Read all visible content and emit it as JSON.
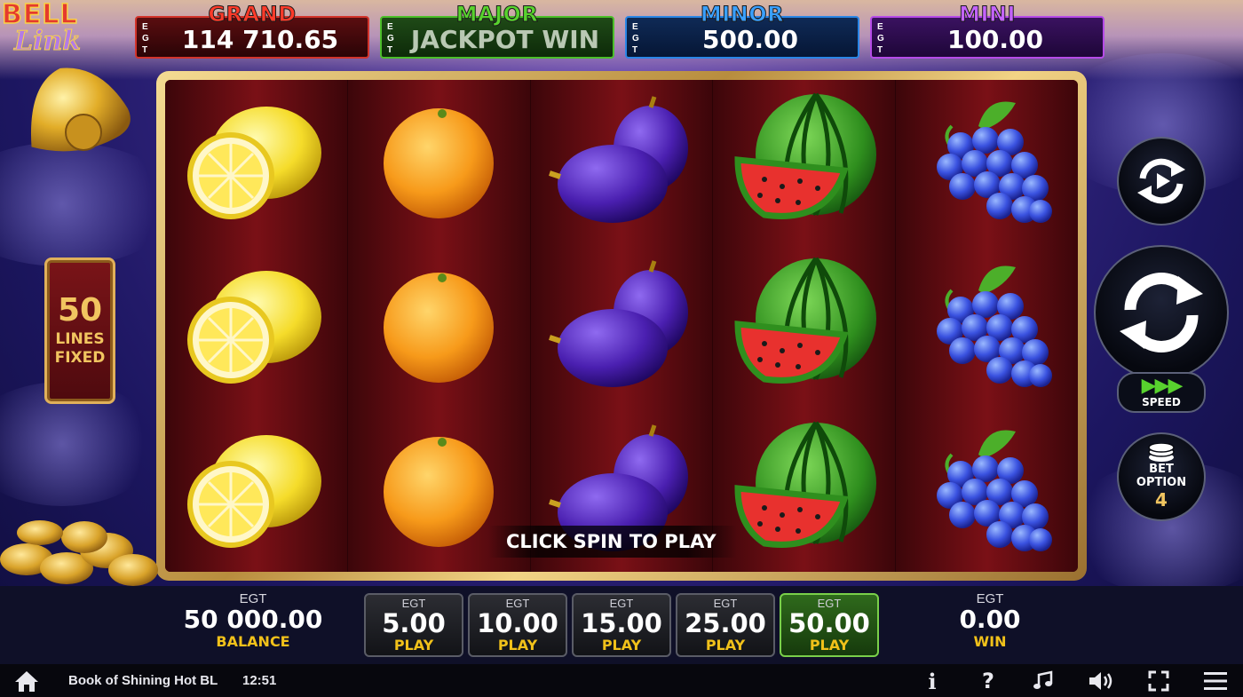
{
  "logo": {
    "line1": "BELL",
    "line2": "Link"
  },
  "jackpots": {
    "grand": {
      "label": "GRAND",
      "value": "114 710.65"
    },
    "major": {
      "label": "MAJOR",
      "value": "JACKPOT WIN"
    },
    "minor": {
      "label": "MINOR",
      "value": "500.00"
    },
    "mini": {
      "label": "MINI",
      "value": "100.00"
    },
    "egt_prefix": [
      "E",
      "G",
      "T"
    ]
  },
  "lines_badge": {
    "number": "50",
    "line1": "LINES",
    "line2": "FIXED"
  },
  "reels": [
    {
      "symbol": "lemon-icon",
      "rows": 3
    },
    {
      "symbol": "orange-icon",
      "rows": 3
    },
    {
      "symbol": "plum-icon",
      "rows": 3
    },
    {
      "symbol": "watermelon-icon",
      "rows": 3
    },
    {
      "symbol": "grapes-icon",
      "rows": 3
    }
  ],
  "message": "CLICK SPIN TO PLAY",
  "controls": {
    "speed_label": "SPEED",
    "bet_option_label_1": "BET",
    "bet_option_label_2": "OPTION",
    "bet_option_value": "4"
  },
  "balance": {
    "currency": "EGT",
    "amount": "50 000.00",
    "label": "BALANCE"
  },
  "bets": [
    {
      "currency": "EGT",
      "amount": "5.00",
      "label": "PLAY",
      "active": false
    },
    {
      "currency": "EGT",
      "amount": "10.00",
      "label": "PLAY",
      "active": false
    },
    {
      "currency": "EGT",
      "amount": "15.00",
      "label": "PLAY",
      "active": false
    },
    {
      "currency": "EGT",
      "amount": "25.00",
      "label": "PLAY",
      "active": false
    },
    {
      "currency": "EGT",
      "amount": "50.00",
      "label": "PLAY",
      "active": true
    }
  ],
  "win": {
    "currency": "EGT",
    "amount": "0.00",
    "label": "WIN"
  },
  "statusbar": {
    "game_name": "Book of Shining Hot BL",
    "time": "12:51",
    "info_glyph": "i",
    "help_glyph": "?"
  },
  "colors": {
    "grand": "#ff3b2a",
    "major": "#58d22e",
    "minor": "#3aa0ff",
    "mini": "#c463ff",
    "gold_label": "#f1c11a"
  }
}
